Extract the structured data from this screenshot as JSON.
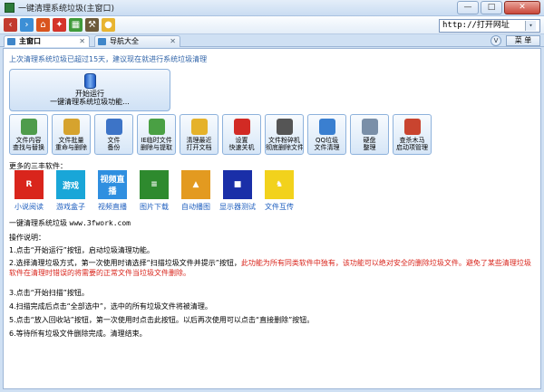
{
  "window": {
    "title": "一键清理系统垃圾(主窗口)",
    "btn_min": "—",
    "btn_max": "□",
    "btn_close": "✕"
  },
  "toolbar": {
    "address": "http://打开网址",
    "address_btn": "▾"
  },
  "tabs": [
    {
      "label": "主窗口",
      "close": "✕"
    },
    {
      "label": "导航大全",
      "close": "✕"
    }
  ],
  "tabbar": {
    "v_label": "V",
    "menu_label": "菜 单"
  },
  "notice": "上次清理系统垃圾已超过15天，建议现在就进行系统垃圾清理",
  "start": {
    "line1": "开始运行",
    "line2": "一键清理系统垃圾功能..."
  },
  "tools": [
    {
      "l1": "文件内容",
      "l2": "查找与替换",
      "color": "#4f9c4c"
    },
    {
      "l1": "文件批量",
      "l2": "重命与删除",
      "color": "#d6a32e"
    },
    {
      "l1": "文件",
      "l2": "备份",
      "color": "#3d74c7"
    },
    {
      "l1": "IE临时文件",
      "l2": "删除与提取",
      "color": "#4aa044"
    },
    {
      "l1": "清理最近",
      "l2": "打开文档",
      "color": "#e5b22a"
    },
    {
      "l1": "设置",
      "l2": "快速关机",
      "color": "#d22a24"
    },
    {
      "l1": "文件粉碎机",
      "l2": "彻底删除文件",
      "color": "#555555"
    },
    {
      "l1": "QQ垃圾",
      "l2": "文件清理",
      "color": "#3a7fd0"
    },
    {
      "l1": "硬盘",
      "l2": "整理",
      "color": "#7a8fa8"
    },
    {
      "l1": "查杀木马",
      "l2": "启动项管理",
      "color": "#c9442f"
    }
  ],
  "more_label": "更多的三丰软件：",
  "apps": [
    {
      "label": "小说阅读",
      "glyph": "R",
      "color": "#d9251c"
    },
    {
      "label": "游戏盒子",
      "glyph": "游戏",
      "color": "#19a6d8"
    },
    {
      "label": "视频直播",
      "glyph": "视频直播",
      "color": "#2f8fe0"
    },
    {
      "label": "图片下载",
      "glyph": "≡",
      "color": "#2e8a2e"
    },
    {
      "label": "自动播图",
      "glyph": "▲",
      "color": "#e39a20"
    },
    {
      "label": "显示器测试",
      "glyph": "■",
      "color": "#1a2fa8"
    },
    {
      "label": "文件互传",
      "glyph": "♞",
      "color": "#f2d21c"
    }
  ],
  "site_name": "一键清理系统垃圾",
  "site_url": "www.3fwork.com",
  "op_heading": "操作说明：",
  "steps": [
    {
      "text": "1.点击“开始运行”按钮，启动垃圾清理功能。",
      "red": ""
    },
    {
      "text": "2.选择清理垃圾方式，第一次使用时请选择“扫描垃圾文件并提示”按钮，",
      "red": "此功能为所有同类软件中独有，该功能可以绝对安全的删除垃圾文件。避免了某些清理垃圾软件在清理时错误的将需要的正常文件当垃圾文件删除。"
    },
    {
      "text": "3.点击“开始扫描”按钮。",
      "red": ""
    },
    {
      "text": "4.扫描完成后点击“全部选中”，选中的所有垃圾文件将被清理。",
      "red": ""
    },
    {
      "text": "5.点击“放入回收站”按钮，第一次使用时点击此按钮。以后再次使用可以点击“直接删除”按钮。",
      "red": ""
    },
    {
      "text": "6.等待所有垃圾文件删除完成。清理结束。",
      "red": ""
    }
  ]
}
